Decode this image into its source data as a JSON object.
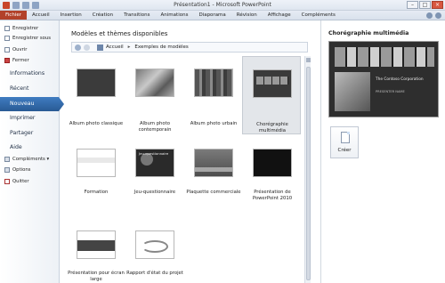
{
  "window": {
    "title": "Présentation1 - Microsoft PowerPoint",
    "controls": [
      "–",
      "□",
      "×"
    ]
  },
  "ribbon": {
    "tabs": [
      "Fichier",
      "Accueil",
      "Insertion",
      "Création",
      "Transitions",
      "Animations",
      "Diaporama",
      "Révision",
      "Affichage",
      "Compléments"
    ]
  },
  "nav": {
    "commands": [
      {
        "label": "Enregistrer",
        "icon": "save-icon"
      },
      {
        "label": "Enregistrer sous",
        "icon": "save-as-icon"
      },
      {
        "label": "Ouvrir",
        "icon": "open-icon"
      },
      {
        "label": "Fermer",
        "icon": "close-doc-icon"
      }
    ],
    "items": [
      "Informations",
      "Récent",
      "Nouveau",
      "Imprimer",
      "Partager",
      "Aide"
    ],
    "active": "Nouveau",
    "footer": [
      {
        "label": "Compléments ▾",
        "icon": "addins-icon"
      },
      {
        "label": "Options",
        "icon": "options-icon"
      },
      {
        "label": "Quitter",
        "icon": "exit-icon"
      }
    ]
  },
  "main": {
    "title": "Modèles et thèmes disponibles",
    "breadcrumb": {
      "home": "Accueil",
      "separator": "▸",
      "current": "Exemples de modèles"
    },
    "templates": [
      {
        "label": "Album photo classique",
        "thumb_text": ""
      },
      {
        "label": "Album photo contemporain",
        "thumb_text": ""
      },
      {
        "label": "Album photo urbain",
        "thumb_text": ""
      },
      {
        "label": "Chorégraphie multimédia",
        "thumb_text": ""
      },
      {
        "label": "Formation",
        "thumb_text": ""
      },
      {
        "label": "Jeu-questionnaire",
        "thumb_text": "Jeu-questionnaire"
      },
      {
        "label": "Plaquette commerciale",
        "thumb_text": ""
      },
      {
        "label": "Présentation de PowerPoint 2010",
        "thumb_text": ""
      },
      {
        "label": "Présentation pour écran large",
        "thumb_text": ""
      },
      {
        "label": "Rapport d'état du projet",
        "thumb_text": ""
      }
    ],
    "selected": "Chorégraphie multimédia"
  },
  "preview": {
    "title": "Chorégraphie multimédia",
    "slide_title": "The Contoso Corporation",
    "slide_subtitle": "PRESENTER NAME",
    "create_label": "Créer"
  },
  "colors": {
    "file_tab": "#b2412a",
    "active_nav": "#3f7cc1"
  }
}
